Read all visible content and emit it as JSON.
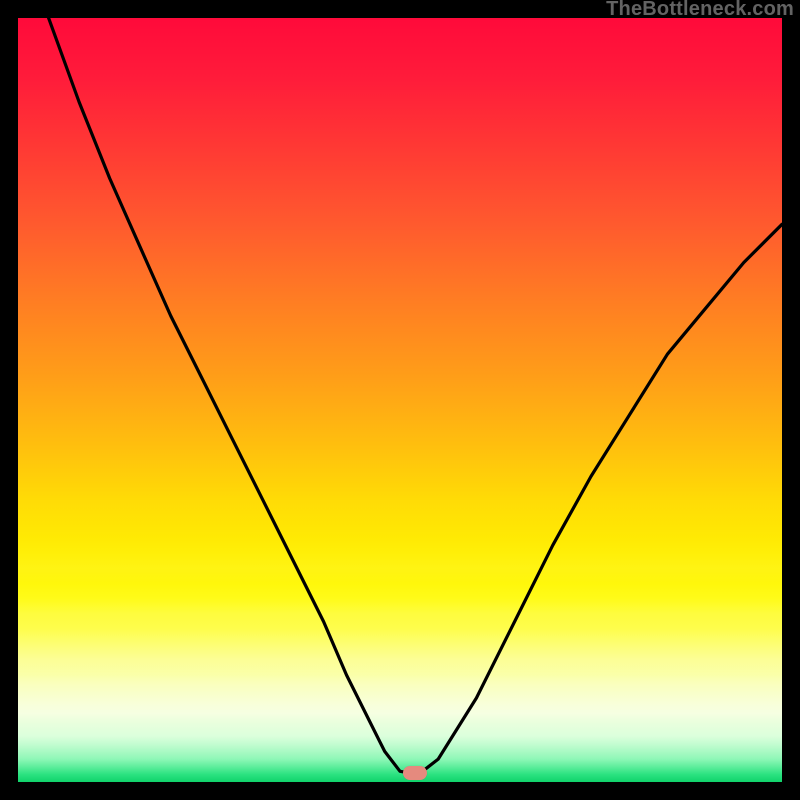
{
  "watermark": "TheBottleneck.com",
  "colors": {
    "frame": "#000000",
    "curve_stroke": "#000000",
    "marker_fill": "#e58a7e",
    "gradient_top": "#ff0a3a",
    "gradient_bottom": "#10d36b"
  },
  "chart_data": {
    "type": "line",
    "title": "",
    "xlabel": "",
    "ylabel": "",
    "xlim": [
      0,
      100
    ],
    "ylim": [
      0,
      100
    ],
    "grid": false,
    "legend": false,
    "series": [
      {
        "name": "bottleneck-curve",
        "x": [
          0,
          4,
          8,
          12,
          16,
          20,
          24,
          28,
          32,
          36,
          40,
          43,
          46,
          48,
          50,
          51.2,
          52.7,
          55,
          60,
          65,
          70,
          75,
          80,
          85,
          90,
          95,
          100
        ],
        "y": [
          112,
          100,
          89,
          79,
          70,
          61,
          53,
          45,
          37,
          29,
          21,
          14,
          8,
          4,
          1.4,
          1.2,
          1.2,
          3,
          11,
          21,
          31,
          40,
          48,
          56,
          62,
          68,
          73
        ]
      }
    ],
    "marker": {
      "x": 52,
      "y": 1.2,
      "shape": "pill"
    },
    "notes": "Values estimated from pixel positions; y expressed as percent of plot height from bottom."
  }
}
